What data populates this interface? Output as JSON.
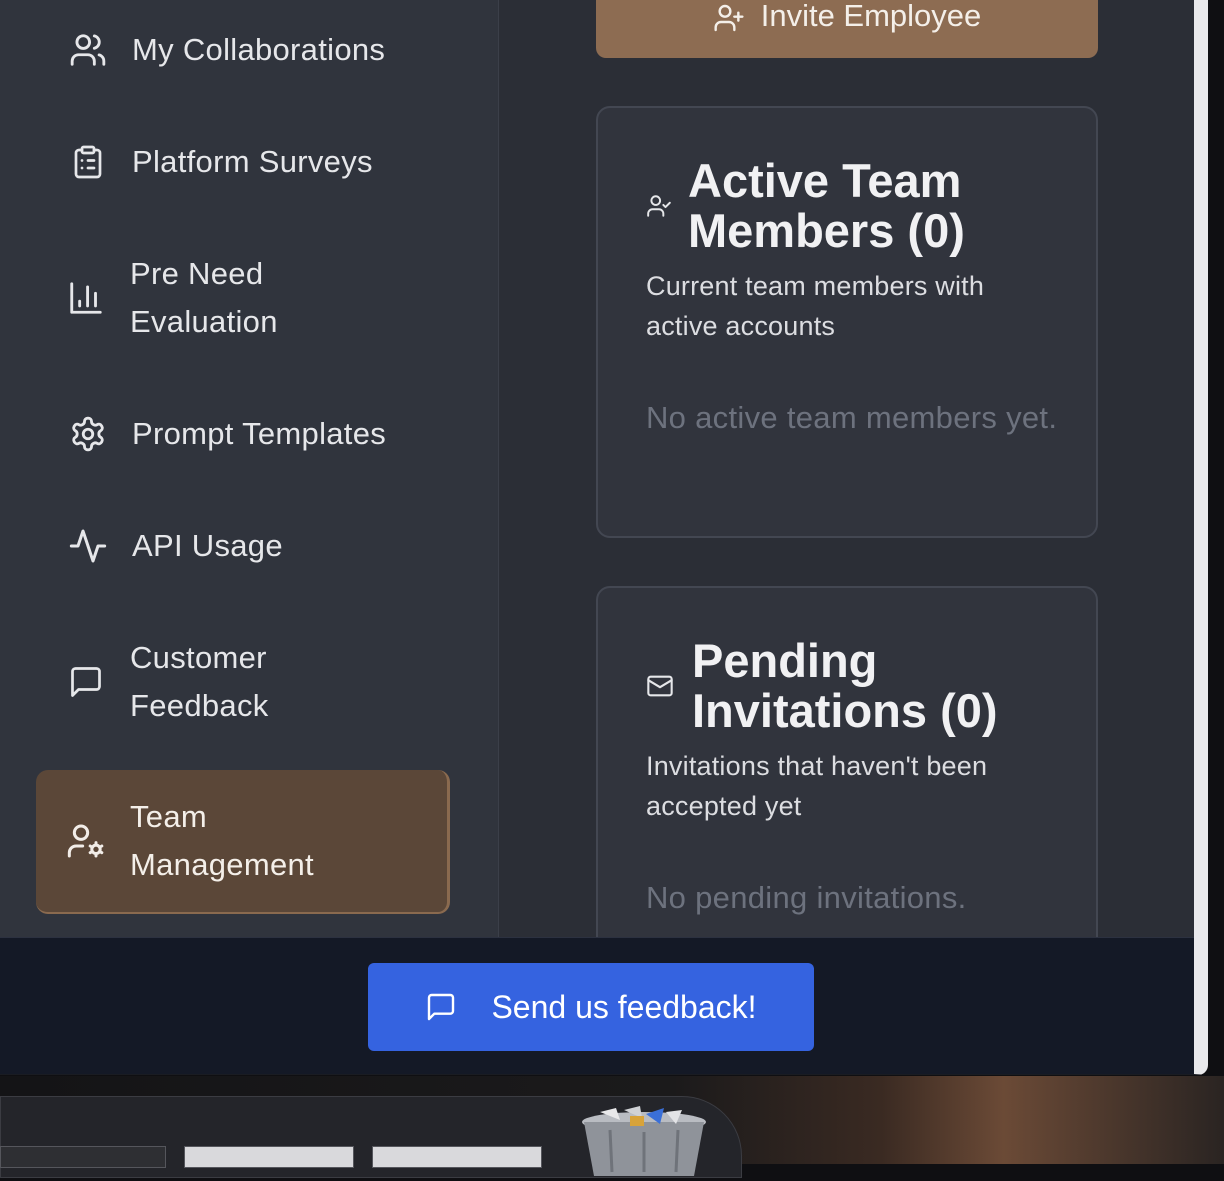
{
  "sidebar": {
    "items": [
      {
        "label": "My Collaborations",
        "icon": "users-icon"
      },
      {
        "label": "Platform Surveys",
        "icon": "clipboard-list-icon"
      },
      {
        "label": "Pre Need\nEvaluation",
        "icon": "bar-chart-icon"
      },
      {
        "label": "Prompt Templates",
        "icon": "gear-icon"
      },
      {
        "label": "API Usage",
        "icon": "activity-icon"
      },
      {
        "label": "Customer\nFeedback",
        "icon": "message-square-icon"
      },
      {
        "label": "Team\nManagement",
        "icon": "user-cog-icon",
        "active": true
      }
    ]
  },
  "main": {
    "invite_label": "Invite Employee",
    "active_card": {
      "title": "Active Team Members (0)",
      "description": "Current team members with active accounts",
      "empty": "No active team members yet."
    },
    "pending_card": {
      "title": "Pending Invitations (0)",
      "description": "Invitations that haven't been accepted yet",
      "empty": "No pending invitations."
    }
  },
  "footer": {
    "feedback_label": "Send us feedback!"
  },
  "colors": {
    "accent": "#8d6c52",
    "active_nav": "#5b4738",
    "feedback_button": "#3563e0"
  }
}
